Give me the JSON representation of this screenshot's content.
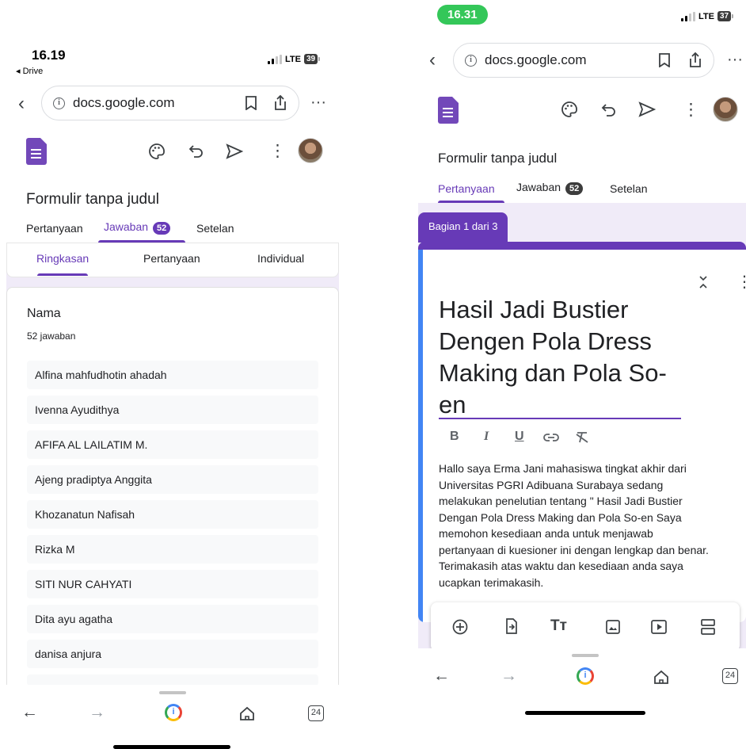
{
  "left": {
    "status": {
      "time": "16.19",
      "back_app": "◂ Drive",
      "network": "LTE",
      "battery": "39"
    },
    "browser": {
      "url": "docs.google.com"
    },
    "form": {
      "title": "Formulir tanpa judul",
      "tabs": [
        {
          "label": "Pertanyaan"
        },
        {
          "label": "Jawaban",
          "badge": "52"
        },
        {
          "label": "Setelan"
        }
      ],
      "subtabs": [
        "Ringkasan",
        "Pertanyaan",
        "Individual"
      ],
      "question": {
        "title": "Nama",
        "count": "52 jawaban",
        "answers": [
          "Alfina mahfudhotin ahadah",
          "Ivenna Ayudithya",
          "AFIFA AL LAILATIM M.",
          "Ajeng pradiptya Anggita",
          "Khozanatun Nafisah",
          "Rizka M",
          "SITI NUR CAHYATI",
          "Dita ayu agatha",
          "danisa anjura"
        ]
      }
    },
    "bottom_nav": {
      "tabs_count": "24"
    }
  },
  "right": {
    "status": {
      "time": "16.31",
      "network": "LTE",
      "battery": "37"
    },
    "browser": {
      "url": "docs.google.com"
    },
    "form": {
      "title": "Formulir tanpa judul",
      "tabs": [
        {
          "label": "Pertanyaan"
        },
        {
          "label": "Jawaban",
          "badge": "52"
        },
        {
          "label": "Setelan"
        }
      ],
      "section_label": "Bagian 1 dari 3",
      "section_title_lines": [
        "Hasil Jadi Bustier",
        "Dengen Pola Dress",
        "Making dan Pola So-",
        "en"
      ],
      "format_buttons": [
        "B",
        "I",
        "U"
      ],
      "description_lines": [
        "Hallo saya Erma Jani mahasiswa tingkat akhir dari",
        "Universitas PGRI Adibuana Surabaya sedang",
        "melakukan penelutian tentang \" Hasil Jadi Bustier",
        "Dengan Pola Dress Making dan Pola So-en Saya",
        "memohon kesediaan anda untuk menjawab",
        "pertanyaan di kuesioner ini dengan lengkap dan benar.",
        "Terimakasih atas waktu dan kesediaan anda saya",
        "ucapkan terimakasih."
      ]
    },
    "bottom_nav": {
      "tabs_count": "24"
    }
  },
  "colors": {
    "accent": "#673ab7",
    "accent_light": "#f0ebf8",
    "status_pill": "#34c759"
  }
}
